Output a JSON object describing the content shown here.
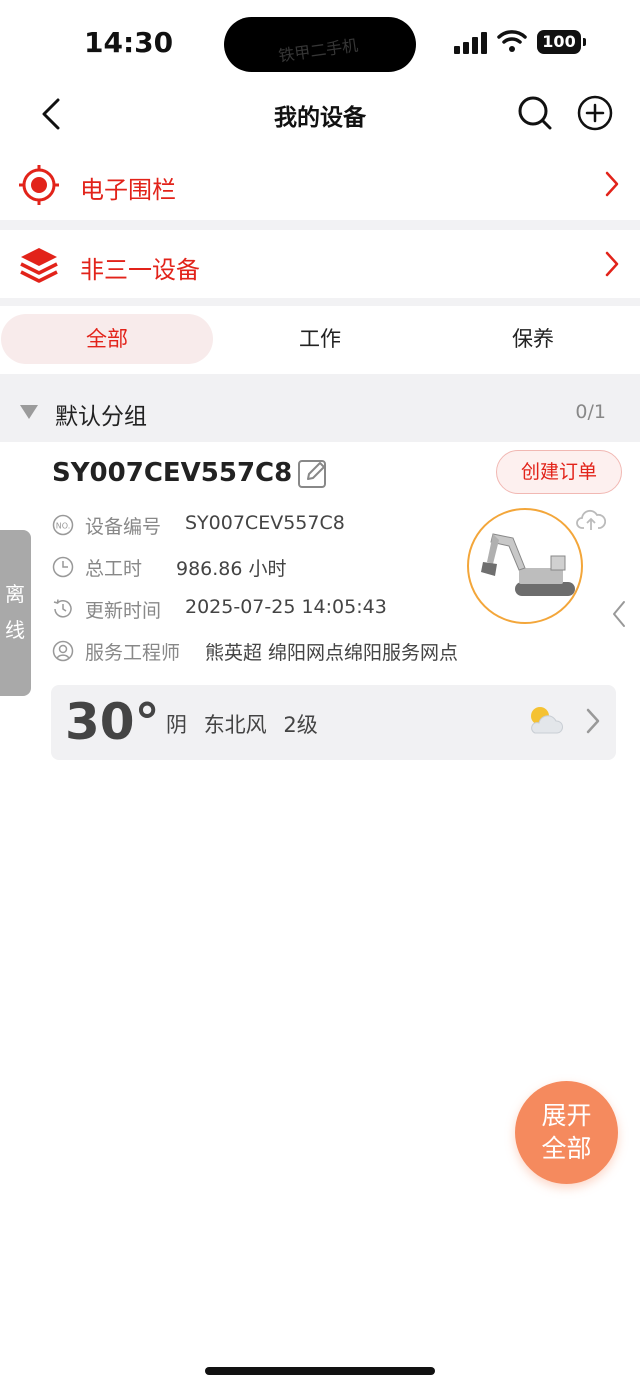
{
  "status_bar": {
    "time": "14:30",
    "battery": "100",
    "watermark": "铁甲二手机"
  },
  "nav": {
    "title": "我的设备"
  },
  "menu": [
    {
      "label": "电子围栏",
      "icon": "location-target-icon"
    },
    {
      "label": "非三一设备",
      "icon": "layers-icon"
    }
  ],
  "tabs": [
    {
      "label": "全部",
      "active": true
    },
    {
      "label": "工作",
      "active": false
    },
    {
      "label": "保养",
      "active": false
    }
  ],
  "group": {
    "name": "默认分组",
    "count": "0/1"
  },
  "device": {
    "status": "离线",
    "id": "SY007CEV557C8",
    "order_button": "创建订单",
    "fields": [
      {
        "icon": "number-icon",
        "key": "设备编号",
        "value": "SY007CEV557C8"
      },
      {
        "icon": "hours-clock-icon",
        "key": "总工时",
        "value": "986.86 小时"
      },
      {
        "icon": "history-clock-icon",
        "key": "更新时间",
        "value": "2025-07-25 14:05:43"
      },
      {
        "icon": "engineer-icon",
        "key": "服务工程师",
        "value": "熊英超  绵阳网点绵阳服务网点"
      }
    ],
    "weather": {
      "temp": "30°",
      "condition": "阴",
      "wind_dir": "东北风",
      "wind_level": "2级",
      "icon": "partly-cloudy-icon"
    }
  },
  "fab": {
    "line1": "展开",
    "line2": "全部"
  },
  "colors": {
    "accent": "#e2231a",
    "fab": "#f58a5e",
    "photo_ring": "#f3a63a"
  }
}
